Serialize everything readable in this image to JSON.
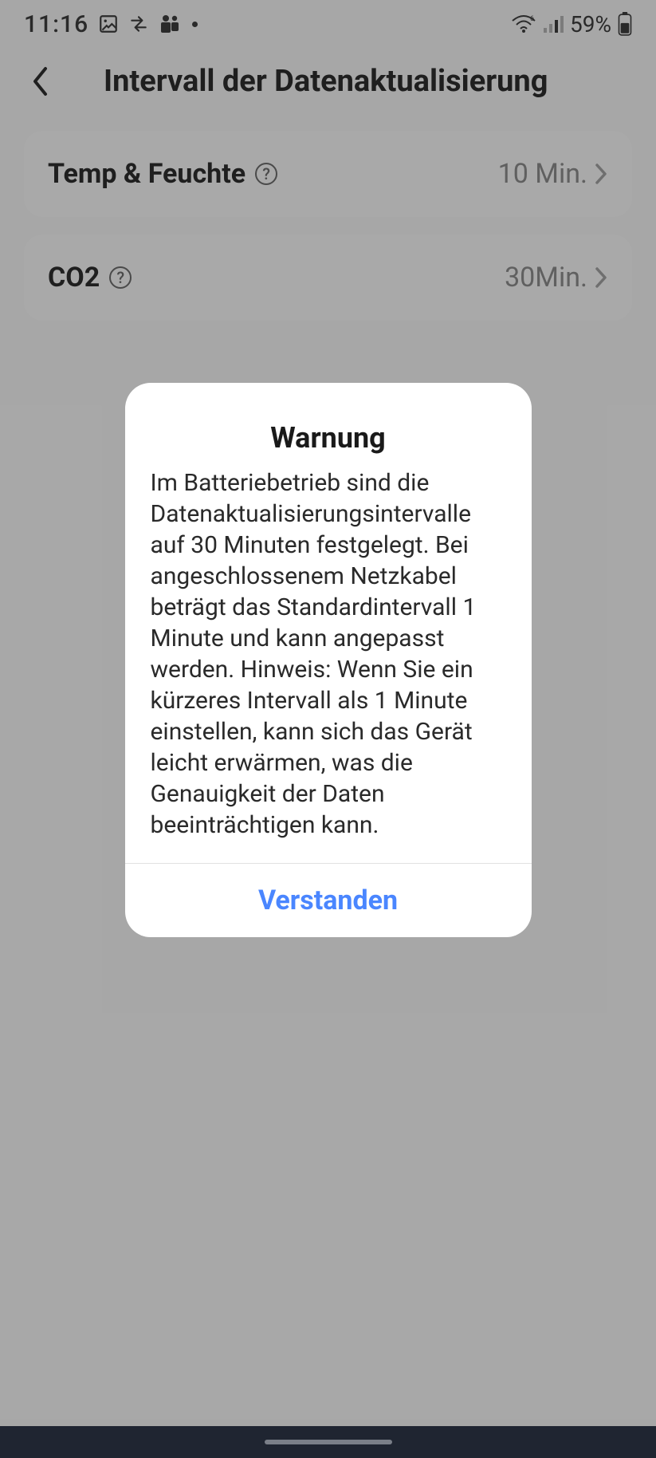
{
  "statusbar": {
    "time": "11:16",
    "battery_pct": "59%"
  },
  "header": {
    "title": "Intervall der Datenaktualisierung"
  },
  "settings": [
    {
      "label": "Temp & Feuchte",
      "value": "10 Min."
    },
    {
      "label": "CO2",
      "value": "30Min."
    }
  ],
  "dialog": {
    "title": "Warnung",
    "body": "Im Batteriebetrieb sind die Datenaktualisierungsintervalle auf 30 Minuten festgelegt. Bei angeschlossenem Netzkabel beträgt das Standardintervall 1 Minute und kann angepasst werden. Hinweis: Wenn Sie ein kürzeres Intervall als 1 Minute einstellen, kann sich das Gerät leicht erwärmen, was die Genauigkeit der Daten beeinträchtigen kann.",
    "button": "Verstanden"
  }
}
